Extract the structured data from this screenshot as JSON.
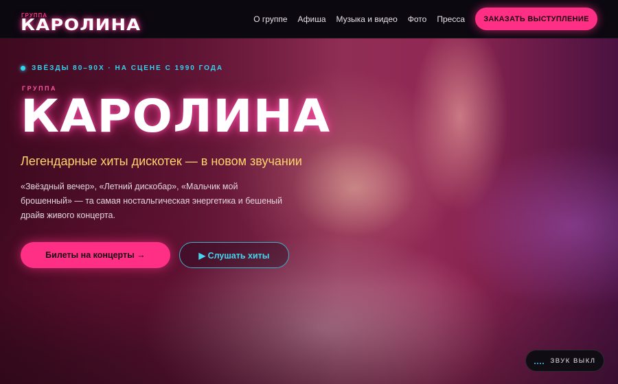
{
  "header": {
    "logo_small": "ГРУППА",
    "logo_main": "КАРОЛИНА",
    "nav": [
      "О группе",
      "Афиша",
      "Музыка и видео",
      "Фото",
      "Пресса"
    ],
    "cta_label": "ЗАКАЗАТЬ ВЫСТУПЛЕНИЕ"
  },
  "hero": {
    "eyebrow": "ЗВЁЗДЫ 80–90Х · НА СЦЕНЕ С 1990 ГОДА",
    "kicker": "ГРУППА",
    "title": "КАРОЛИНА",
    "subtitle": "Легендарные хиты дискотек — в новом звучании",
    "description": "«Звёздный вечер», «Летний дискобар», «Мальчик мой брошенный» — та самая ностальгическая энергетика и бешеный драйв живого концерта.",
    "primary_button": "Билеты на концерты →",
    "secondary_button": "▶ Слушать хиты"
  },
  "sound": {
    "label": "ЗВУК ВЫКЛ",
    "icon": "equalizer-icon"
  },
  "colors": {
    "accent_pink": "#ff2f86",
    "accent_cyan": "#34d3ee",
    "subtitle_yellow": "#ffd46b",
    "header_bg": "#0b0810"
  }
}
